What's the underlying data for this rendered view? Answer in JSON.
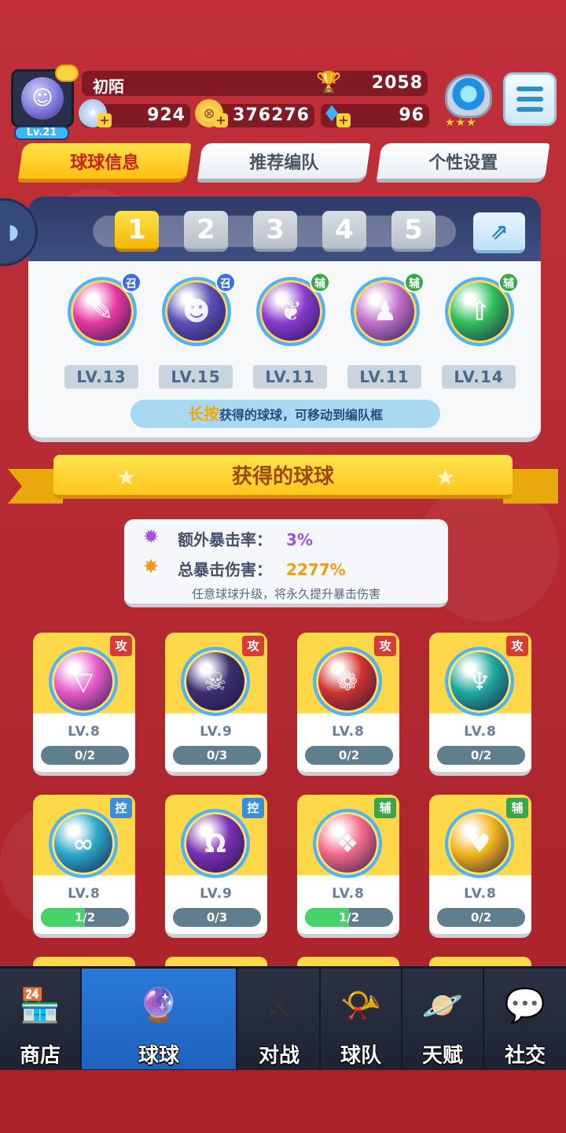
{
  "player": {
    "name": "初陌",
    "level": "Lv.21",
    "trophies": "2058",
    "energy": "924",
    "gold": "376276",
    "gems": "96",
    "rank_stars": "★★★"
  },
  "tabs": [
    {
      "label": "球球信息",
      "active": true
    },
    {
      "label": "推荐编队",
      "active": false
    },
    {
      "label": "个性设置",
      "active": false
    }
  ],
  "team": {
    "slots": [
      "1",
      "2",
      "3",
      "4",
      "5"
    ],
    "active_slot": "1",
    "balls": [
      {
        "tag": "召",
        "level": "LV.13",
        "color": "#e53aa0"
      },
      {
        "tag": "召",
        "level": "LV.15",
        "color": "#5b4fb8"
      },
      {
        "tag": "辅",
        "level": "LV.11",
        "color": "#8a3ad0"
      },
      {
        "tag": "辅",
        "level": "LV.11",
        "color": "#c070c8"
      },
      {
        "tag": "辅",
        "level": "LV.14",
        "color": "#2fbf5a"
      }
    ],
    "hint_highlight": "长按",
    "hint_text": "获得的球球，可移动到编队框"
  },
  "owned_title": "获得的球球",
  "crit": {
    "extra_rate_label": "额外暴击率：",
    "extra_rate_value": "3%",
    "total_damage_label": "总暴击伤害：",
    "total_damage_value": "2277%",
    "note": "任意球球升级，将永久提升暴击伤害"
  },
  "owned_balls": [
    {
      "tag": "攻",
      "level": "LV.8",
      "progress": "0/2",
      "fill": 0,
      "color": "#e75bc8"
    },
    {
      "tag": "攻",
      "level": "LV.9",
      "progress": "0/3",
      "fill": 0,
      "color": "#3b2f6e"
    },
    {
      "tag": "攻",
      "level": "LV.8",
      "progress": "0/2",
      "fill": 0,
      "color": "#d0342e"
    },
    {
      "tag": "攻",
      "level": "LV.8",
      "progress": "0/2",
      "fill": 0,
      "color": "#1ea8a0"
    },
    {
      "tag": "控",
      "level": "LV.8",
      "progress": "1/2",
      "fill": 0.5,
      "color": "#2aa7c9"
    },
    {
      "tag": "控",
      "level": "LV.9",
      "progress": "0/3",
      "fill": 0,
      "color": "#7a2fb0"
    },
    {
      "tag": "辅",
      "level": "LV.8",
      "progress": "1/2",
      "fill": 0.5,
      "color": "#f06a8a"
    },
    {
      "tag": "辅",
      "level": "LV.8",
      "progress": "0/2",
      "fill": 0,
      "color": "#f2b31a"
    }
  ],
  "nav": [
    {
      "label": "商店",
      "icon": "shop-icon",
      "active": false
    },
    {
      "label": "球球",
      "icon": "ball-icon",
      "active": true
    },
    {
      "label": "对战",
      "icon": "swords-icon",
      "active": false
    },
    {
      "label": "球队",
      "icon": "whistle-icon",
      "active": false
    },
    {
      "label": "天赋",
      "icon": "planet-icon",
      "active": false
    },
    {
      "label": "社交",
      "icon": "chat-icon",
      "active": false
    }
  ]
}
